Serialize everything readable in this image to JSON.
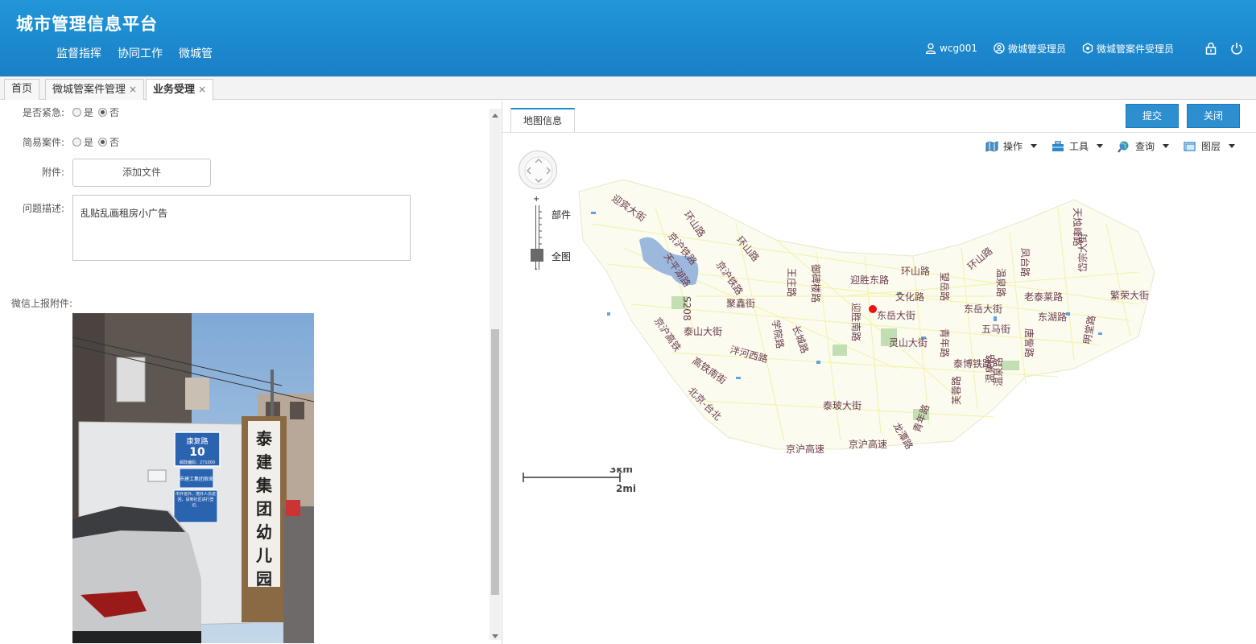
{
  "header": {
    "app_title": "城市管理信息平台",
    "nav": [
      "监督指挥",
      "协同工作",
      "微城管"
    ],
    "user_name": "wcg001",
    "role1": "微城管受理员",
    "role2": "微城管案件受理员"
  },
  "tabs": [
    {
      "label": "首页",
      "closable": false
    },
    {
      "label": "微城管案件管理",
      "closable": true
    },
    {
      "label": "业务受理",
      "closable": true,
      "active": true
    }
  ],
  "form": {
    "urgent_label": "是否紧急:",
    "simple_label": "简易案件:",
    "yes": "是",
    "no": "否",
    "attach_label": "附件:",
    "add_file": "添加文件",
    "desc_label": "问题描述:",
    "desc_value": "乱贴乱画租房小广告",
    "wx_attach_label": "微信上报附件:"
  },
  "photo": {
    "sign_road": "康复路",
    "sign_number": "10",
    "sign_postcode": "邮政编码：271000",
    "sign_dorm": "市建工集团宿舍",
    "sign_notice": "市外省外、境外人员返回，请到社区进行登记。",
    "vertical_sign": [
      "泰",
      "建",
      "集",
      "团",
      "幼",
      "儿",
      "园"
    ]
  },
  "right": {
    "map_tab": "地图信息",
    "submit": "提交",
    "close": "关闭",
    "tools": [
      "操作",
      "工具",
      "查询",
      "图层"
    ],
    "zoom_top": "部件",
    "zoom_bottom": "全图",
    "zoom_plus": "+",
    "zoom_minus": "-",
    "scale_km": "3km",
    "scale_mi": "2mi"
  },
  "map_labels": [
    "迎宾大街",
    "环山路",
    "京沪铁路",
    "环山路",
    "天平湖路",
    "京沪铁路",
    "S208",
    "聚鑫街",
    "泰山大街",
    "京沪高铁",
    "泮河西路",
    "学院路",
    "长城路",
    "王庄路",
    "御碑楼路",
    "迎胜东路",
    "迎胜南路",
    "环山路",
    "文化路",
    "东岳大街",
    "灵山大街",
    "望岳路",
    "青年路",
    "环山路",
    "东岳大街",
    "五马街",
    "泰博铁路",
    "温泉路",
    "老泰莱路",
    "东湖路",
    "天烛峰路",
    "凤台路",
    "温泉路",
    "唐訾路",
    "岱宗大街",
    "繁荣大街",
    "明堂路",
    "高铁南街",
    "北京-台北",
    "泰玻大街",
    "京沪高速",
    "京沪高速",
    "龙潭路",
    "青年路",
    "芙蓉路",
    "温泉路"
  ]
}
